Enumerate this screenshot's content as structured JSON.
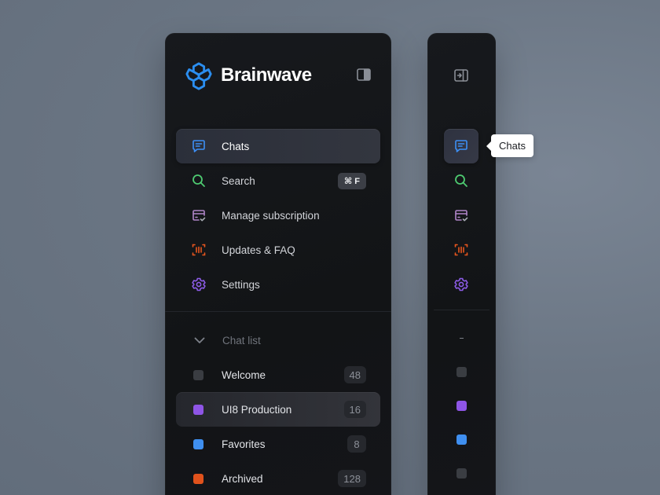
{
  "brand": {
    "name": "Brainwave",
    "logo_icon": "brain-hex-logo",
    "accent": "#2b8ef0"
  },
  "nav": {
    "items": [
      {
        "label": "Chats",
        "icon": "chat-bubble-icon",
        "color": "#3d8ff5",
        "active": true
      },
      {
        "label": "Search",
        "icon": "search-icon",
        "color": "#4ecb71",
        "shortcut": "⌘ F"
      },
      {
        "label": "Manage subscription",
        "icon": "card-check-icon",
        "color": "#b085c8"
      },
      {
        "label": "Updates & FAQ",
        "icon": "barcode-scan-icon",
        "color": "#e8561e"
      },
      {
        "label": "Settings",
        "icon": "gear-icon",
        "color": "#8d5ce8"
      }
    ]
  },
  "chat_list": {
    "header": "Chat list",
    "items": [
      {
        "label": "Welcome",
        "count": "48",
        "color": "#3a3d42"
      },
      {
        "label": "UI8 Production",
        "count": "16",
        "color": "#8e55e6",
        "active": true
      },
      {
        "label": "Favorites",
        "count": "8",
        "color": "#3f8ff0"
      },
      {
        "label": "Archived",
        "count": "128",
        "color": "#e0521c"
      }
    ]
  },
  "tooltip": {
    "text": "Chats"
  }
}
